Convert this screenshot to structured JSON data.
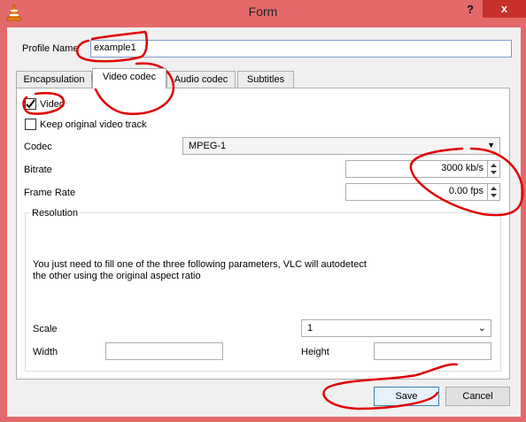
{
  "window": {
    "title": "Form",
    "help": "?",
    "close": "x"
  },
  "profile": {
    "label": "Profile Name",
    "value": "example1"
  },
  "tabs": [
    {
      "label": "Encapsulation"
    },
    {
      "label": "Video codec"
    },
    {
      "label": "Audio codec"
    },
    {
      "label": "Subtitles"
    }
  ],
  "video": {
    "enable_label": "Video",
    "enable_checked": true,
    "keep_label": "Keep original video track",
    "keep_checked": false,
    "codec_label": "Codec",
    "codec_value": "MPEG-1",
    "bitrate_label": "Bitrate",
    "bitrate_value": "3000 kb/s",
    "framerate_label": "Frame Rate",
    "framerate_value": "0.00 fps"
  },
  "resolution": {
    "title": "Resolution",
    "info_line1": "You just need to fill one of the three following parameters, VLC will autodetect",
    "info_line2": "the other using the original aspect ratio",
    "scale_label": "Scale",
    "scale_value": "1",
    "width_label": "Width",
    "height_label": "Height"
  },
  "buttons": {
    "save": "Save",
    "cancel": "Cancel"
  },
  "colors": {
    "titlebar": "#e46a6a",
    "close": "#c7302b",
    "annotation": "#e00000"
  }
}
